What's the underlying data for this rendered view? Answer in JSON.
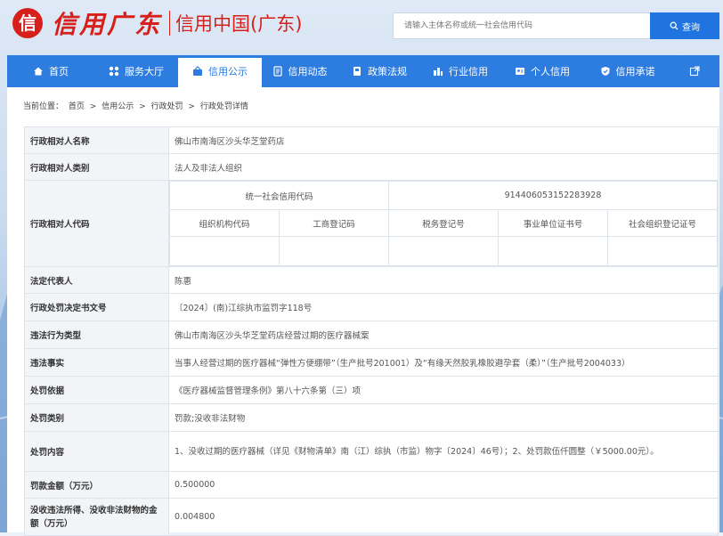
{
  "header": {
    "logo_mark": "信",
    "logo_text": "信用广东",
    "sub_title": "信用中国(广东)",
    "search_placeholder": "请输入主体名称或统一社会信用代码",
    "search_button": "查询"
  },
  "nav": {
    "items": [
      {
        "label": "首页",
        "icon": "home-icon"
      },
      {
        "label": "服务大厅",
        "icon": "grid-icon"
      },
      {
        "label": "信用公示",
        "icon": "publicity-icon",
        "active": true
      },
      {
        "label": "信用动态",
        "icon": "news-icon"
      },
      {
        "label": "政策法规",
        "icon": "book-icon"
      },
      {
        "label": "行业信用",
        "icon": "industry-icon"
      },
      {
        "label": "个人信用",
        "icon": "id-card-icon"
      },
      {
        "label": "信用承诺",
        "icon": "shield-icon"
      }
    ],
    "external_icon": "external-link-icon"
  },
  "breadcrumb": {
    "prefix": "当前位置：",
    "items": [
      "首页",
      "信用公示",
      "行政处罚",
      "行政处罚详情"
    ],
    "separator": ">"
  },
  "table": {
    "rows": [
      {
        "key": "行政相对人名称",
        "value": "佛山市南海区沙头华芝堂药店"
      },
      {
        "key": "行政相对人类别",
        "value": "法人及非法人组织"
      },
      {
        "key": "法定代表人",
        "value": "陈惠"
      },
      {
        "key": "行政处罚决定书文号",
        "value": "〔2024〕(南)江综执市监罚字118号"
      },
      {
        "key": "违法行为类型",
        "value": "佛山市南海区沙头华芝堂药店经营过期的医疗器械案"
      },
      {
        "key": "违法事实",
        "value": "当事人经营过期的医疗器械“弹性方便绷带”（生产批号201001）及“有缘天然胶乳橡胶避孕套（柔）”（生产批号2004033）"
      },
      {
        "key": "处罚依据",
        "value": "《医疗器械监督管理条例》第八十六条第（三）项"
      },
      {
        "key": "处罚类别",
        "value": "罚款;没收非法财物"
      },
      {
        "key": "处罚内容",
        "value": "1、没收过期的医疗器械（详见《财物清单》南（江）综执（市监）物字〔2024〕46号）；2、处罚款伍仟圆整（￥5000.00元）。"
      },
      {
        "key": "罚款金额（万元）",
        "value": "0.500000"
      },
      {
        "key": "没收违法所得、没收非法财物的金额（万元）",
        "value": "0.004800"
      }
    ],
    "codes": {
      "key": "行政相对人代码",
      "uscc_label": "统一社会信用代码",
      "uscc_value": "914406053152283928",
      "columns": [
        "组织机构代码",
        "工商登记码",
        "税务登记号",
        "事业单位证书号",
        "社会组织登记证号"
      ],
      "values": [
        "",
        "",
        "",
        "",
        ""
      ]
    }
  },
  "colors": {
    "brand_red": "#d7201c",
    "nav_blue": "#2d7ce0",
    "search_blue": "#1f74e0",
    "key_bg": "#f2f4f7"
  }
}
